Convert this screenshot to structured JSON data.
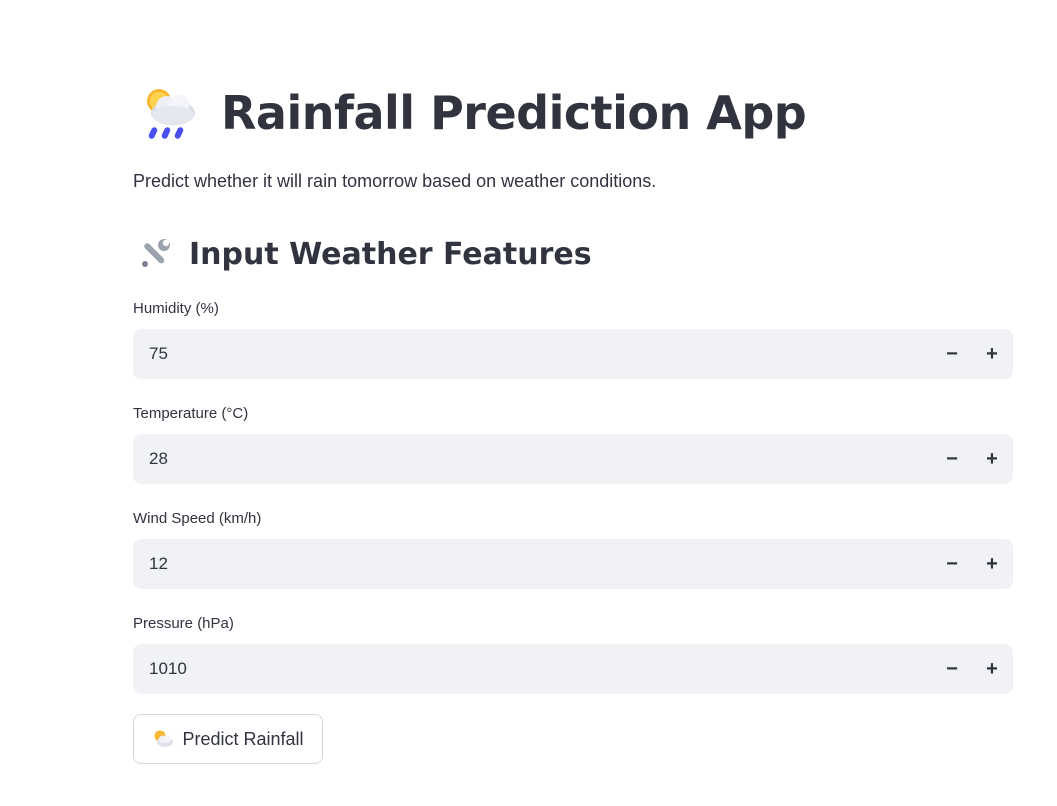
{
  "header": {
    "title": "Rainfall Prediction App",
    "title_icon": "cloud-sun-rain-icon",
    "subtitle": "Predict whether it will rain tomorrow based on weather conditions."
  },
  "section": {
    "title": "Input Weather Features",
    "icon": "wrench-icon"
  },
  "fields": [
    {
      "label": "Humidity (%)",
      "value": "75",
      "minus": "−",
      "plus": "+"
    },
    {
      "label": "Temperature (°C)",
      "value": "28",
      "minus": "−",
      "plus": "+"
    },
    {
      "label": "Wind Speed (km/h)",
      "value": "12",
      "minus": "−",
      "plus": "+"
    },
    {
      "label": "Pressure (hPa)",
      "value": "1010",
      "minus": "−",
      "plus": "+"
    }
  ],
  "predict_button": {
    "label": "Predict Rainfall",
    "icon": "sun-behind-cloud-icon"
  },
  "colors": {
    "text": "#31333f",
    "input_bg": "#f0f2f6",
    "button_border": "#d6d6d9",
    "raindrop": "#4b4ef0"
  }
}
